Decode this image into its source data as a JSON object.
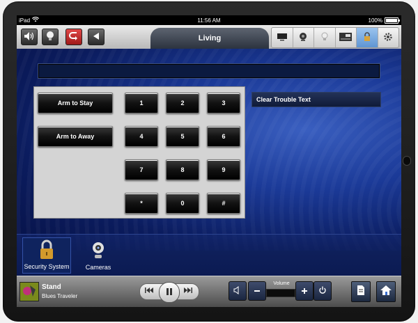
{
  "status_bar": {
    "carrier": "iPad",
    "time": "11:56 AM",
    "battery": "100%"
  },
  "room_title": "Living",
  "keypad": {
    "arm_stay": "Arm to Stay",
    "arm_away": "Arm to Away",
    "keys": [
      "1",
      "2",
      "3",
      "4",
      "5",
      "6",
      "7",
      "8",
      "9",
      "*",
      "0",
      "#"
    ],
    "clear_trouble": "Clear Trouble Text"
  },
  "tray": {
    "items": [
      {
        "label": "Security System",
        "icon": "lock-icon",
        "selected": true
      },
      {
        "label": "Cameras",
        "icon": "camera-icon",
        "selected": false
      }
    ]
  },
  "media": {
    "title": "Stand",
    "artist": "Blues Traveler",
    "volume_label": "Volume"
  },
  "colors": {
    "accent": "#1b3a98",
    "active_device": "#7fb0e4"
  }
}
